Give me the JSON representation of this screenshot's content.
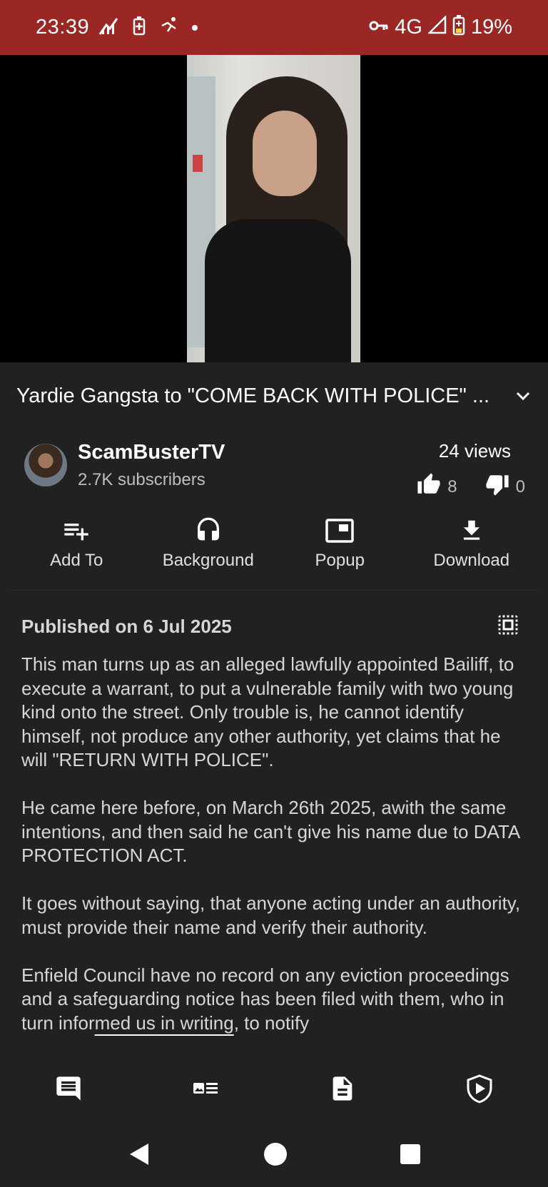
{
  "status_bar": {
    "time": "23:39",
    "network": "4G",
    "battery": "19%",
    "colors": {
      "background": "#9b2724"
    },
    "icons": [
      "signal-chart-icon",
      "battery-saver-icon",
      "accessibility-icon",
      "notification-dot-icon",
      "vpn-key-icon",
      "cell-signal-icon",
      "battery-icon"
    ]
  },
  "video": {
    "title": "Yardie Gangsta to \"COME BACK WITH POLICE\" ...",
    "expand_icon": "chevron-down-icon"
  },
  "channel": {
    "name": "ScamBusterTV",
    "subscribers": "2.7K subscribers",
    "views": "24 views",
    "likes": "8",
    "dislikes": "0"
  },
  "actions": [
    {
      "label": "Add To",
      "icon": "playlist-add-icon"
    },
    {
      "label": "Background",
      "icon": "headphones-icon"
    },
    {
      "label": "Popup",
      "icon": "popup-window-icon"
    },
    {
      "label": "Download",
      "icon": "download-icon"
    }
  ],
  "description": {
    "published": "Published on 6 Jul 2025",
    "select_icon": "select-all-icon",
    "paragraphs": [
      "This man turns up as an alleged lawfully appointed Bailiff, to execute a warrant, to put a vulnerable family with two young kind onto the street. Only trouble is, he cannot identify himself, not produce any other authority, yet claims that he will \"RETURN WITH POLICE\".",
      "He came here before, on March 26th 2025, awith the same intentions, and then said he can't give his name due to DATA PROTECTION ACT.",
      "It goes without saying, that anyone acting under an authority, must provide their name and verify their authority."
    ],
    "last_paragraph": {
      "before": "Enfield Council have no record on any eviction proceedings and a safeguarding notice has been filed with them, who in turn infor",
      "underlined": "med us in writing",
      "after": ", to notify"
    }
  },
  "tabs": [
    {
      "name": "comments",
      "icon": "comment-icon"
    },
    {
      "name": "related",
      "icon": "related-items-icon"
    },
    {
      "name": "description",
      "icon": "document-icon"
    },
    {
      "name": "sponsorblock",
      "icon": "shield-play-icon"
    }
  ],
  "system_nav": [
    "back-icon",
    "home-icon",
    "recents-icon"
  ]
}
